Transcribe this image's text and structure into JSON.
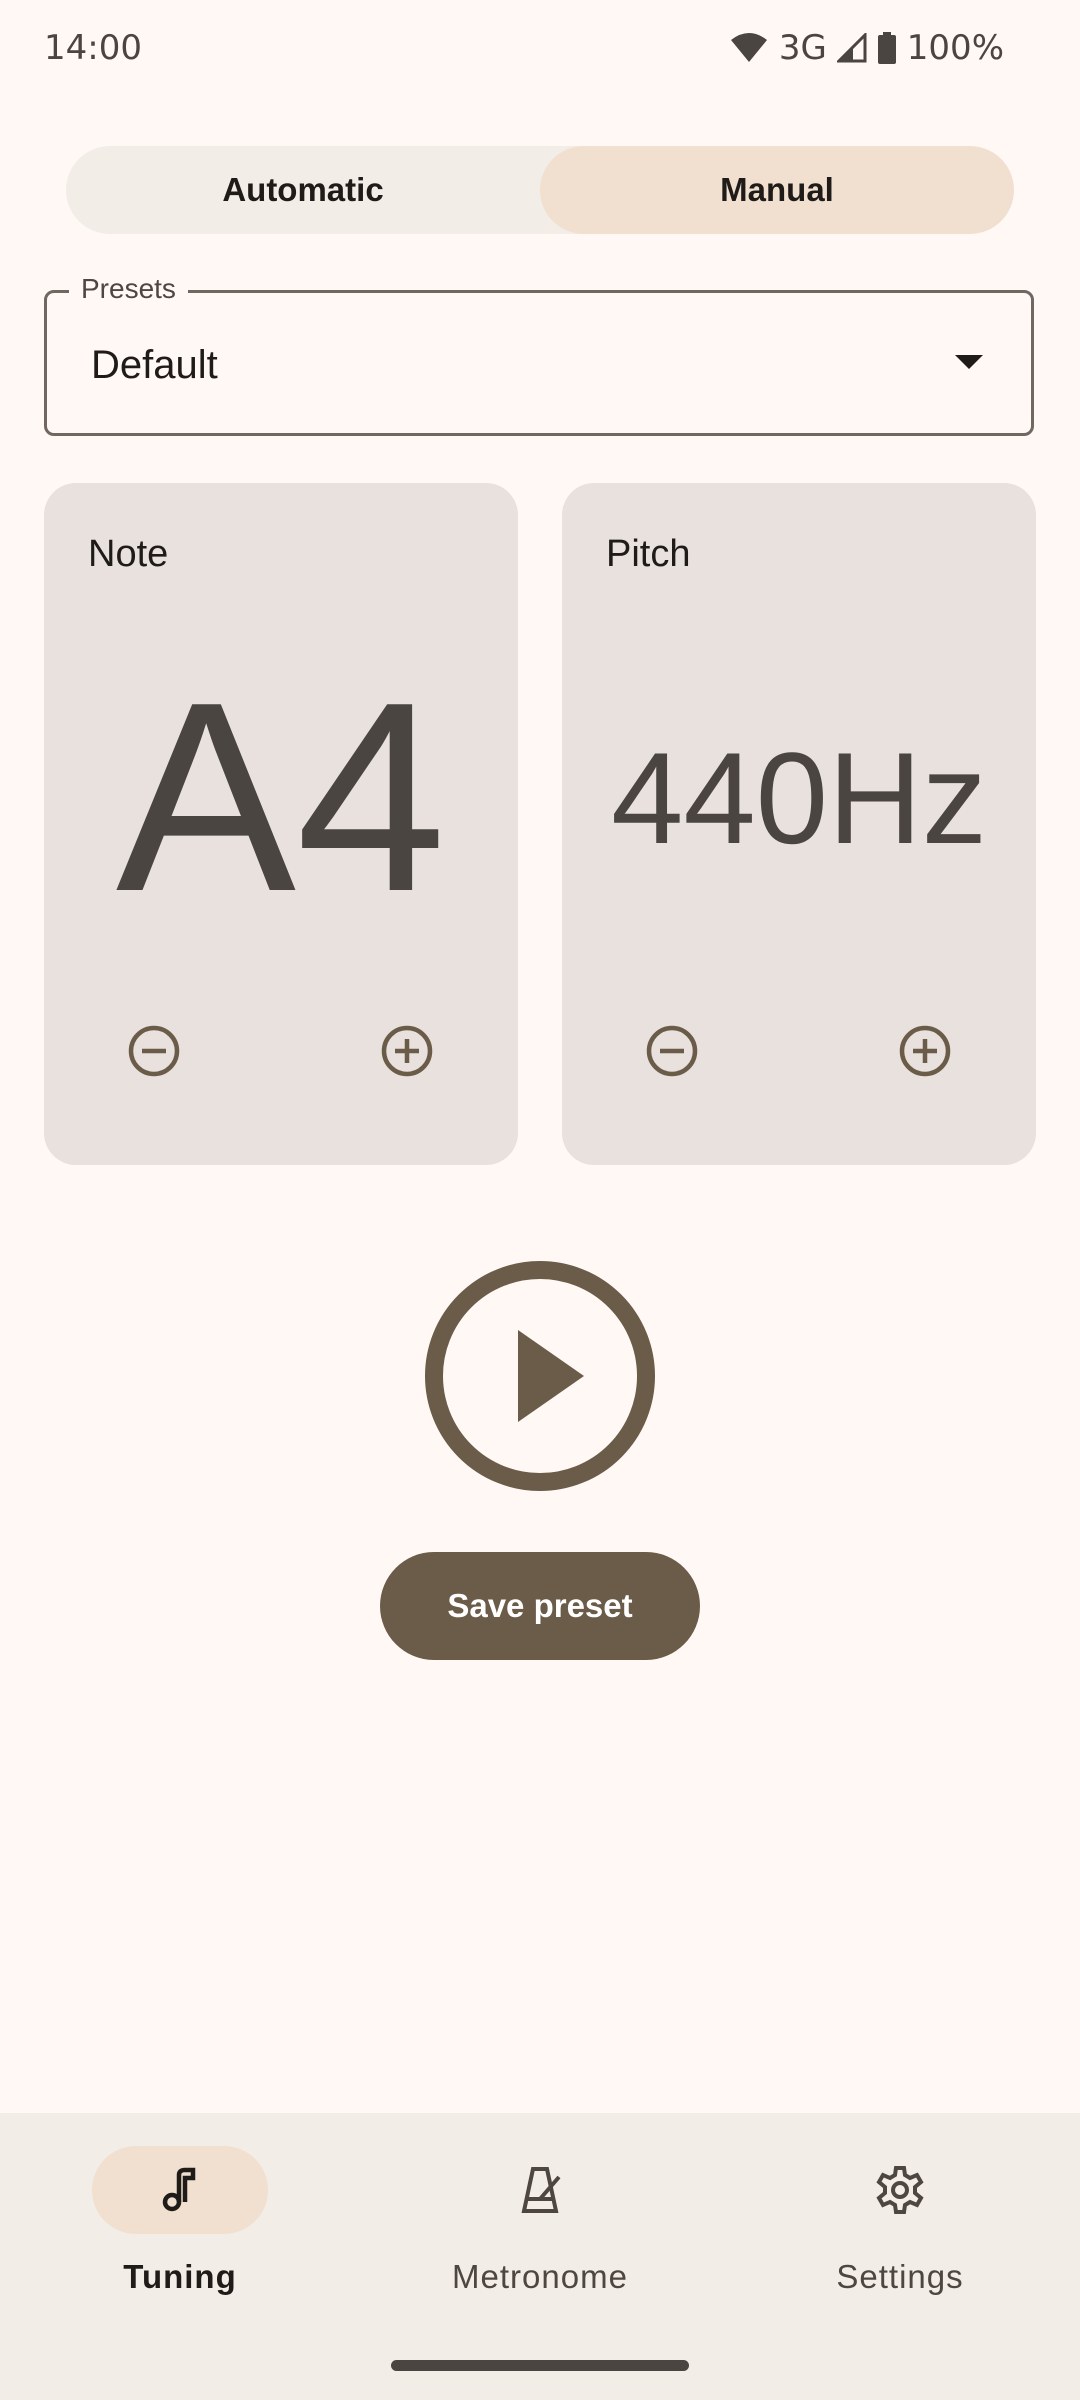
{
  "status_bar": {
    "time": "14:00",
    "network": "3G",
    "battery": "100%",
    "icons": [
      "wifi-icon",
      "signal-icon",
      "battery-icon"
    ]
  },
  "mode_toggle": {
    "options": [
      {
        "label": "Automatic",
        "selected": false
      },
      {
        "label": "Manual",
        "selected": true
      }
    ]
  },
  "presets": {
    "label": "Presets",
    "value": "Default"
  },
  "note_card": {
    "title": "Note",
    "value": "A4"
  },
  "pitch_card": {
    "title": "Pitch",
    "value": "440Hz"
  },
  "play": {
    "icon": "play-icon"
  },
  "save_button": {
    "label": "Save preset"
  },
  "bottom_nav": {
    "items": [
      {
        "label": "Tuning",
        "icon": "music-note-icon",
        "selected": true
      },
      {
        "label": "Metronome",
        "icon": "metronome-icon",
        "selected": false
      },
      {
        "label": "Settings",
        "icon": "gear-icon",
        "selected": false
      }
    ]
  },
  "colors": {
    "background": "#fff8f5",
    "accent": "#6b5c49",
    "selected_container": "#f1e0cf",
    "card": "#e8e1dd"
  }
}
